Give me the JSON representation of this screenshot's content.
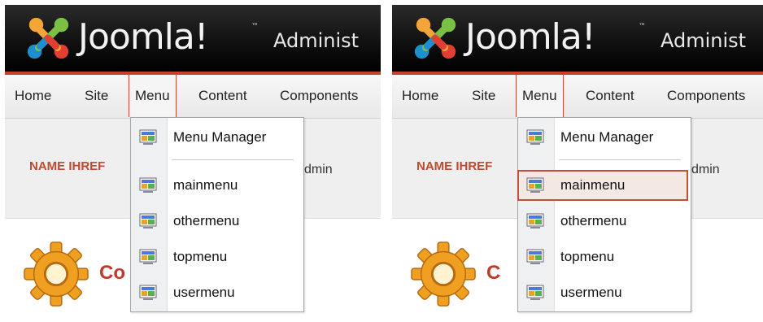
{
  "panels": [
    {
      "header": {
        "logo_text": "Joomla!",
        "logo_tm": "™",
        "admin_text": "Administ"
      },
      "menubar": {
        "home": "Home",
        "site": "Site",
        "menu": "Menu",
        "content": "Content",
        "components": "Components"
      },
      "band": {
        "name_label": "NAME IHREF",
        "admin_partial": "dmin"
      },
      "gear_title": "Co",
      "dropdown": {
        "manager": "Menu Manager",
        "items": [
          "mainmenu",
          "othermenu",
          "topmenu",
          "usermenu"
        ],
        "highlighted": null
      }
    },
    {
      "header": {
        "logo_text": "Joomla!",
        "logo_tm": "™",
        "admin_text": "Administ"
      },
      "menubar": {
        "home": "Home",
        "site": "Site",
        "menu": "Menu",
        "content": "Content",
        "components": "Components"
      },
      "band": {
        "name_label": "NAME IHREF",
        "admin_partial": "dmin"
      },
      "gear_title": "C",
      "dropdown": {
        "manager": "Menu Manager",
        "items": [
          "mainmenu",
          "othermenu",
          "topmenu",
          "usermenu"
        ],
        "highlighted": "mainmenu"
      }
    }
  ],
  "colors": {
    "accent": "#c6422a",
    "highlight_bg": "#f3e8e4",
    "name_label": "#c0492f"
  },
  "icons": {
    "logo": "joomla-logo-icon",
    "menu_item": "menu-item-icon",
    "gear": "gear-icon"
  }
}
